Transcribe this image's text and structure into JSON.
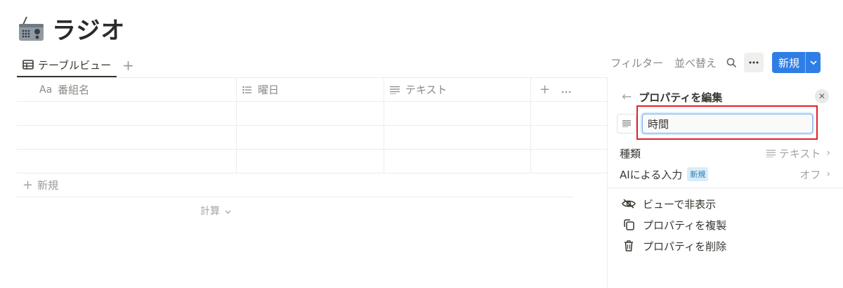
{
  "page": {
    "title": "ラジオ",
    "icon": "radio-icon"
  },
  "view_tabs": [
    {
      "label": "テーブルビュー",
      "icon": "table-icon",
      "active": true
    }
  ],
  "toolbar": {
    "filter_label": "フィルター",
    "sort_label": "並べ替え",
    "new_label": "新規"
  },
  "table": {
    "columns": [
      {
        "label": "番組名",
        "icon": "title-icon",
        "icon_text": "Aa"
      },
      {
        "label": "曜日",
        "icon": "multi-select-icon"
      },
      {
        "label": "テキスト",
        "icon": "text-icon"
      }
    ],
    "add_row_label": "新規",
    "calc_label": "計算"
  },
  "property_panel": {
    "title": "プロパティを編集",
    "name_value": "時間",
    "type_label": "種類",
    "type_value": "テキスト",
    "ai_label": "AIによる入力",
    "ai_badge": "新規",
    "ai_value": "オフ",
    "actions": [
      {
        "label": "ビューで非表示",
        "icon": "eye-off-icon"
      },
      {
        "label": "プロパティを複製",
        "icon": "duplicate-icon"
      },
      {
        "label": "プロパティを削除",
        "icon": "trash-icon"
      }
    ]
  },
  "colors": {
    "accent": "#2f7ee6",
    "highlight": "#e41f26",
    "text": "#37352f",
    "muted": "#8a8985"
  }
}
